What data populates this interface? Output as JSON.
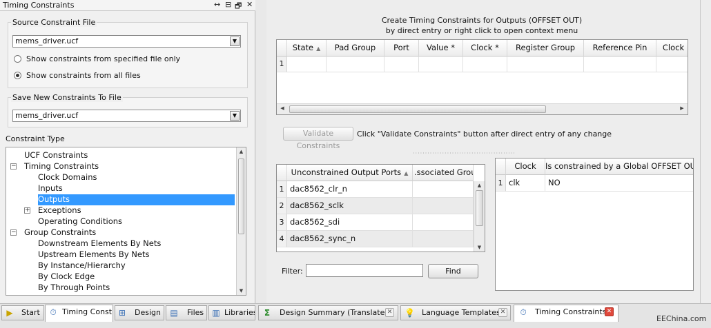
{
  "left_panel": {
    "title": "Timing Constraints",
    "controls": [
      "↔",
      "⊟",
      "🗗",
      "✕"
    ],
    "source_file": {
      "legend": "Source Constraint File",
      "value": "mems_driver.ucf",
      "radio_specified": "Show constraints from specified file only",
      "radio_all": "Show constraints from all files",
      "selected": "all"
    },
    "save_file": {
      "legend": "Save New Constraints To File",
      "value": "mems_driver.ucf"
    },
    "constraint_type_label": "Constraint Type",
    "tree": [
      {
        "label": "UCF Constraints",
        "level": 0,
        "expander": ""
      },
      {
        "label": "Timing Constraints",
        "level": 0,
        "expander": "−"
      },
      {
        "label": "Clock Domains",
        "level": 1,
        "expander": ""
      },
      {
        "label": "Inputs",
        "level": 1,
        "expander": ""
      },
      {
        "label": "Outputs",
        "level": 1,
        "expander": "",
        "selected": true
      },
      {
        "label": "Exceptions",
        "level": 1,
        "expander": "+"
      },
      {
        "label": "Operating Conditions",
        "level": 1,
        "expander": ""
      },
      {
        "label": "Group Constraints",
        "level": 0,
        "expander": "−"
      },
      {
        "label": "Downstream Elements By Nets",
        "level": 1,
        "expander": ""
      },
      {
        "label": "Upstream Elements By Nets",
        "level": 1,
        "expander": ""
      },
      {
        "label": "By Instance/Hierarchy",
        "level": 1,
        "expander": ""
      },
      {
        "label": "By Clock Edge",
        "level": 1,
        "expander": ""
      },
      {
        "label": "By Through Points",
        "level": 1,
        "expander": ""
      }
    ]
  },
  "main": {
    "heading_line1": "Create Timing Constraints for Outputs (OFFSET OUT)",
    "heading_line2": "by direct entry or right click to open context menu",
    "top_table": {
      "columns": [
        "State",
        "Pad Group",
        "Port",
        "Value *",
        "Clock *",
        "Register Group",
        "Reference Pin",
        "Clock"
      ],
      "row_numbers": [
        "1"
      ]
    },
    "validate_button": "Validate Constraints",
    "validate_hint": "Click \"Validate Constraints\" button after direct entry of any change",
    "ports_table": {
      "columns": [
        "Unconstrained Output Ports",
        ".ssociated Grou"
      ],
      "rows": [
        {
          "num": "1",
          "port": "dac8562_clr_n",
          "group": ""
        },
        {
          "num": "2",
          "port": "dac8562_sclk",
          "group": ""
        },
        {
          "num": "3",
          "port": "dac8562_sdi",
          "group": ""
        },
        {
          "num": "4",
          "port": "dac8562_sync_n",
          "group": ""
        }
      ]
    },
    "clock_table": {
      "columns": [
        "Clock",
        "Is constrained by a Global OFFSET OUT"
      ],
      "rows": [
        {
          "num": "1",
          "clock": "clk",
          "constrained": "NO"
        }
      ]
    },
    "filter_label": "Filter:",
    "filter_value": "",
    "find_button": "Find"
  },
  "tabs": {
    "left": [
      {
        "label": "Start",
        "icon": "start-icon",
        "glyph": "▶"
      },
      {
        "label": "Timing Const...",
        "icon": "timing-icon",
        "glyph": "⏱",
        "active": true
      },
      {
        "label": "Design",
        "icon": "design-icon",
        "glyph": "⊞"
      },
      {
        "label": "Files",
        "icon": "files-icon",
        "glyph": "▤"
      },
      {
        "label": "Libraries",
        "icon": "libraries-icon",
        "glyph": "▥"
      }
    ],
    "right": [
      {
        "label": "Design Summary (Translated)",
        "icon": "sigma-icon",
        "glyph": "Σ",
        "close": "✕"
      },
      {
        "label": "Language Templates",
        "icon": "lightbulb-icon",
        "glyph": "💡",
        "close": "✕"
      },
      {
        "label": "Timing Constraints",
        "icon": "timing-icon",
        "glyph": "⏱",
        "close": "✕",
        "active": true
      }
    ]
  },
  "watermark": "EEChina.com",
  "colors": {
    "selection": "#3399ff",
    "close_active": "#e0493c"
  }
}
